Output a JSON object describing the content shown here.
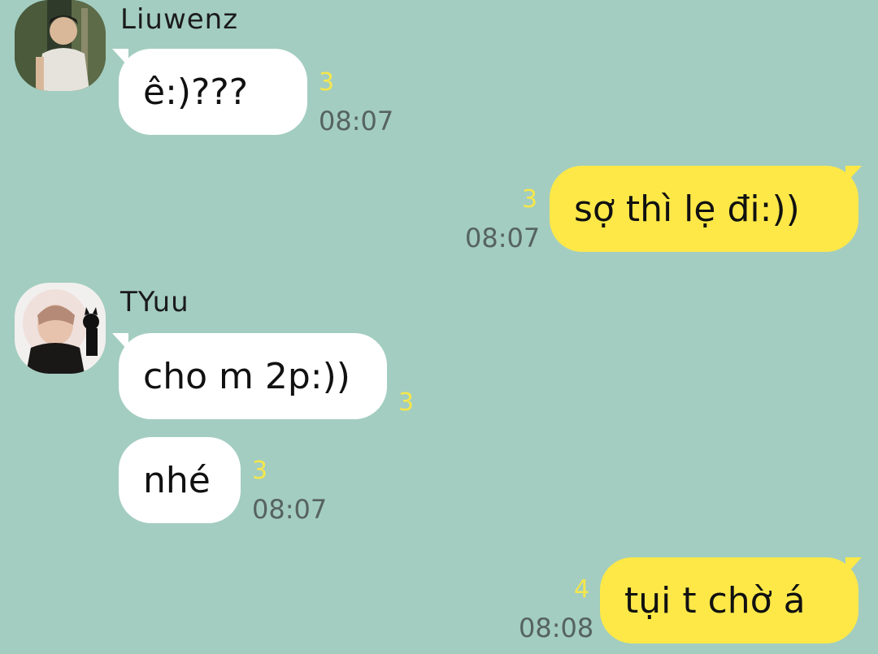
{
  "theme": {
    "background": "#a3cdc0",
    "incoming_bubble": "#ffffff",
    "outgoing_bubble": "#fde848",
    "unread_color": "#f5e64b",
    "time_color": "#56635f"
  },
  "messages": [
    {
      "sender": "Liuwenz",
      "avatar_icon": "profile-photo-icon",
      "text": "ê:)???",
      "unread": "3",
      "time": "08:07"
    },
    {
      "text": "sợ thì lẹ đi:))",
      "unread": "3",
      "time": "08:07"
    },
    {
      "sender": "TYuu",
      "avatar_icon": "profile-photo-icon",
      "text": "cho m 2p:))",
      "unread": "3"
    },
    {
      "text": "nhé",
      "unread": "3",
      "time": "08:07"
    },
    {
      "text": "tụi t chờ á",
      "unread": "4",
      "time": "08:08"
    }
  ]
}
